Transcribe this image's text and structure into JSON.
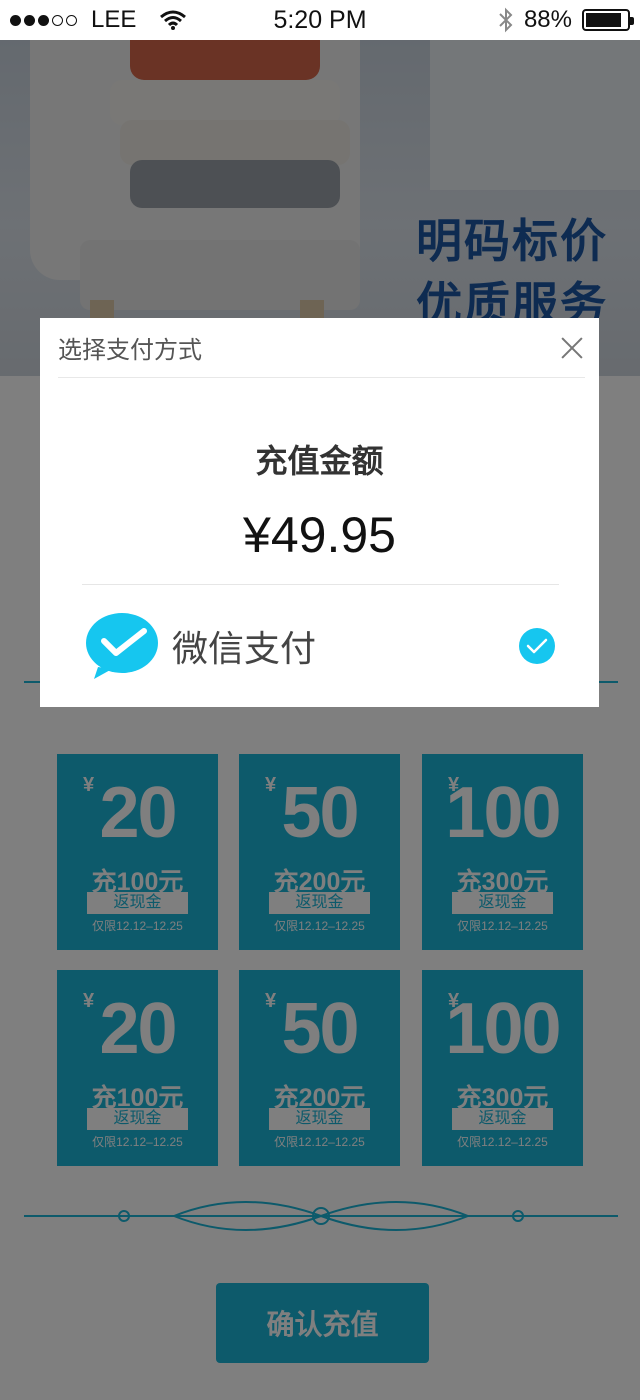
{
  "status_bar": {
    "carrier": "LEE",
    "time": "5:20 PM",
    "battery": "88%",
    "battery_level": 0.88
  },
  "banner": {
    "line1": "明码标价",
    "line2": "优质服务"
  },
  "modal": {
    "title": "选择支付方式",
    "amount_label": "充值金额",
    "amount": "¥49.95",
    "payment_method": "微信支付",
    "payment_selected": true
  },
  "coupons": [
    {
      "yen": "¥",
      "value": "20",
      "recharge": "充100元",
      "tag": "返现金",
      "date": "仅限12.12–12.25"
    },
    {
      "yen": "¥",
      "value": "50",
      "recharge": "充200元",
      "tag": "返现金",
      "date": "仅限12.12–12.25"
    },
    {
      "yen": "¥",
      "value": "100",
      "recharge": "充300元",
      "tag": "返现金",
      "date": "仅限12.12–12.25"
    },
    {
      "yen": "¥",
      "value": "20",
      "recharge": "充100元",
      "tag": "返现金",
      "date": "仅限12.12–12.25"
    },
    {
      "yen": "¥",
      "value": "50",
      "recharge": "充200元",
      "tag": "返现金",
      "date": "仅限12.12–12.25"
    },
    {
      "yen": "¥",
      "value": "100",
      "recharge": "充300元",
      "tag": "返现金",
      "date": "仅限12.12–12.25"
    }
  ],
  "confirm_button": "确认充值",
  "colors": {
    "accent": "#1ab4d7",
    "check": "#16c6ef",
    "banner_text": "#1c57a3"
  },
  "icons": [
    "signal-icon",
    "wifi-icon",
    "bluetooth-icon",
    "battery-icon",
    "close-icon",
    "wechat-pay-icon",
    "check-icon",
    "ornament-divider"
  ]
}
